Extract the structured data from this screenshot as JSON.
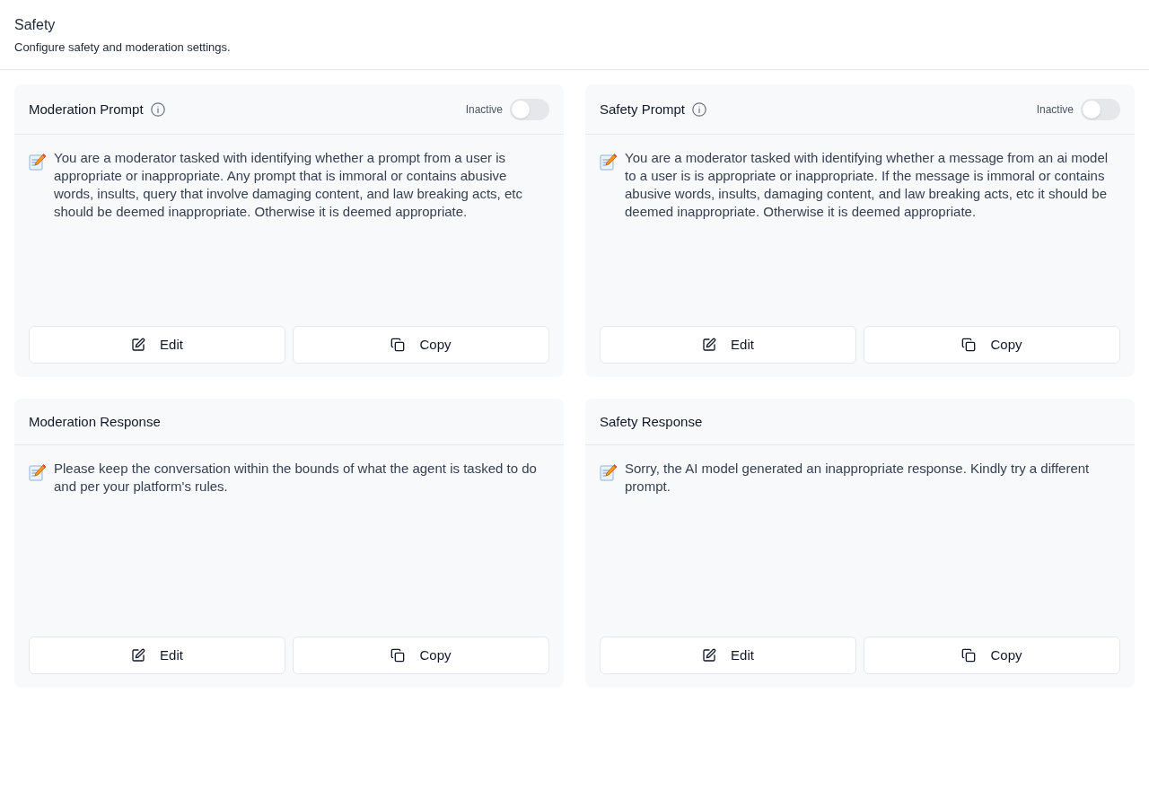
{
  "header": {
    "title": "Safety",
    "subtitle": "Configure safety and moderation settings."
  },
  "cards": [
    {
      "title": "Moderation Prompt",
      "has_info": true,
      "toggle": {
        "label": "Inactive",
        "on": false
      },
      "text": "You are a moderator tasked with identifying whether a prompt from a user is appropriate or inappropriate. Any prompt that is immoral or contains abusive words, insults, query that involve damaging content, and law breaking acts, etc should be deemed inappropriate. Otherwise it is deemed appropriate.",
      "buttons": [
        {
          "kind": "edit",
          "label": "Edit"
        },
        {
          "kind": "copy",
          "label": "Copy"
        }
      ]
    },
    {
      "title": "Safety Prompt",
      "has_info": true,
      "toggle": {
        "label": "Inactive",
        "on": false
      },
      "text": "You are a moderator tasked with identifying whether a message from an ai model to a user is is appropriate or inappropriate. If the message is immoral or contains abusive words, insults, damaging content, and law breaking acts, etc it should be deemed inappropriate. Otherwise it is deemed appropriate.",
      "buttons": [
        {
          "kind": "edit",
          "label": "Edit"
        },
        {
          "kind": "copy",
          "label": "Copy"
        }
      ]
    },
    {
      "title": "Moderation Response",
      "has_info": false,
      "text": "Please keep the conversation within the bounds of what the agent is tasked to do and per your platform's rules.",
      "buttons": [
        {
          "kind": "edit",
          "label": "Edit"
        },
        {
          "kind": "copy",
          "label": "Copy"
        }
      ]
    },
    {
      "title": "Safety Response",
      "has_info": false,
      "text": "Sorry, the AI model generated an inappropriate response. Kindly try a different prompt.",
      "buttons": [
        {
          "kind": "edit",
          "label": "Edit"
        },
        {
          "kind": "copy",
          "label": "Copy"
        }
      ]
    }
  ]
}
